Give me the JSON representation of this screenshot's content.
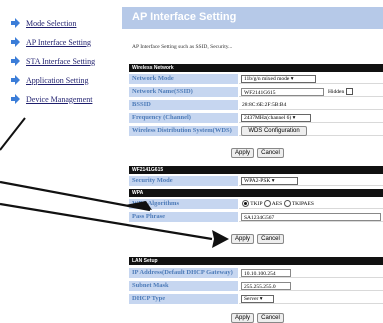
{
  "sidebar": {
    "items": [
      {
        "label": "Mode Selection"
      },
      {
        "label": "AP Interface Setting"
      },
      {
        "label": "STA Interface Setting"
      },
      {
        "label": "Application Setting"
      },
      {
        "label": "Device Management"
      }
    ],
    "arrow_color": "#3b7dd8"
  },
  "header": {
    "title": "AP Interface Setting"
  },
  "description": "AP Interface Setting such as SSID, Security...",
  "wireless": {
    "section": "Wireless Network",
    "network_mode_label": "Network Mode",
    "network_mode_value": "11b/g/n mixed mode ▾",
    "ssid_label": "Network Name(SSID)",
    "ssid_value": "WF2141G615",
    "hidden_label": "Hidden",
    "bssid_label": "BSSID",
    "bssid_value": "28:8C:6E:2F:5B:B4",
    "freq_label": "Frequency (Channel)",
    "freq_value": "2437MHz(channel 6) ▾",
    "wds_label": "Wireless Distribution System(WDS)",
    "wds_button": "WDS Configuration",
    "apply": "Apply",
    "cancel": "Cancel"
  },
  "security": {
    "section": "WF2141G615",
    "mode_label": "Security Mode",
    "mode_value": "WPA2-PSK    ▾",
    "wpa_section": "WPA",
    "algo_label": "WPA Algorithms",
    "algo_options": [
      "TKIP",
      "AES",
      "TKIPAES"
    ],
    "pass_label": "Pass Phrase",
    "pass_value": "SA1234G567",
    "apply": "Apply",
    "cancel": "Cancel"
  },
  "lan": {
    "section": "LAN Setup",
    "ip_label": "IP Address(Default DHCP Gateway)",
    "ip_value": "10.10.100.254",
    "mask_label": "Subnet Mask",
    "mask_value": "255.255.255.0",
    "dhcp_label": "DHCP Type",
    "dhcp_value": "Server ▾",
    "apply": "Apply",
    "cancel": "Cancel"
  }
}
